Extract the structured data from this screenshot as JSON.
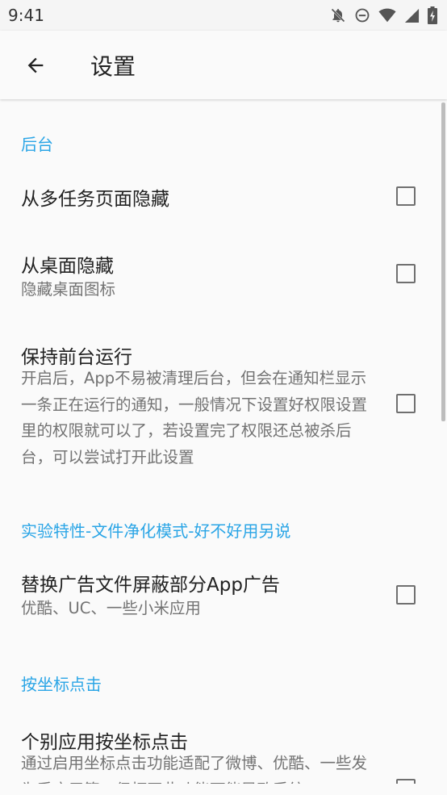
{
  "status_bar": {
    "time": "9:41",
    "icons": [
      "bell-off-icon",
      "do-not-disturb-icon",
      "wifi-icon",
      "signal-icon",
      "battery-charging-icon"
    ]
  },
  "app_bar": {
    "back_icon": "arrow-left-icon",
    "title": "设置"
  },
  "sections": {
    "background": {
      "header": "后台",
      "items": [
        {
          "title": "从多任务页面隐藏",
          "summary": "",
          "checked": false
        },
        {
          "title": "从桌面隐藏",
          "summary": "隐藏桌面图标",
          "checked": false
        },
        {
          "title": "保持前台运行",
          "summary": "开启后，App不易被清理后台，但会在通知栏显示一条正在运行的通知，一般情况下设置好权限设置里的权限就可以了，若设置完了权限还总被杀后台，可以尝试打开此设置",
          "checked": false
        }
      ]
    },
    "experimental": {
      "header": "实验特性-文件净化模式-好不好用另说",
      "items": [
        {
          "title": "替换广告文件屏蔽部分App广告",
          "summary": "优酷、UC、一些小米应用",
          "checked": false
        }
      ]
    },
    "coordinate_click": {
      "header": "按坐标点击",
      "items": [
        {
          "title": "个别应用按坐标点击",
          "summary": "通过启用坐标点击功能适配了微博、优酷、一些发为手应用等，但打开此功能可能导致系统",
          "checked": false
        }
      ]
    }
  },
  "colors": {
    "accent": "#2aa5e6",
    "text_primary": "#212121",
    "text_secondary": "#737373",
    "checkbox_border": "#6f6f6f"
  }
}
